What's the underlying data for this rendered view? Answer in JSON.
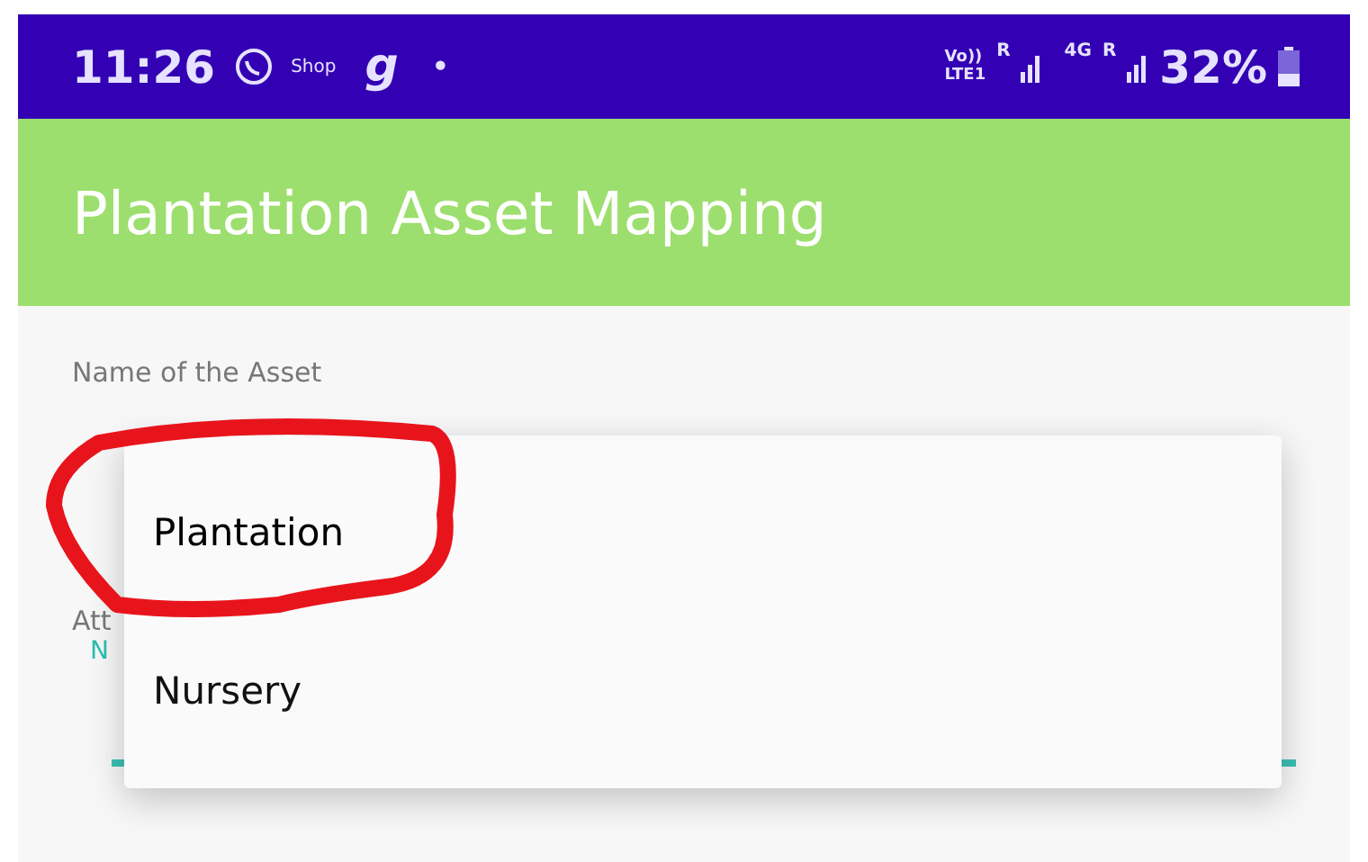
{
  "status_bar": {
    "time": "11:26",
    "shop_label": "Shop",
    "app_glyph": "g",
    "dot": "•",
    "volte_top": "Vo))",
    "volte_bottom": "LTE1",
    "sim1_roaming": "R",
    "network_type": "4G",
    "sim2_roaming": "R",
    "battery": "32%"
  },
  "app_bar": {
    "title": "Plantation Asset Mapping"
  },
  "form": {
    "name_label": "Name of the Asset",
    "attribute_label": "Att",
    "attribute_value": "N"
  },
  "dropdown": {
    "options": [
      {
        "label": "Plantation",
        "highlighted": true
      },
      {
        "label": "Nursery",
        "highlighted": false
      }
    ]
  }
}
